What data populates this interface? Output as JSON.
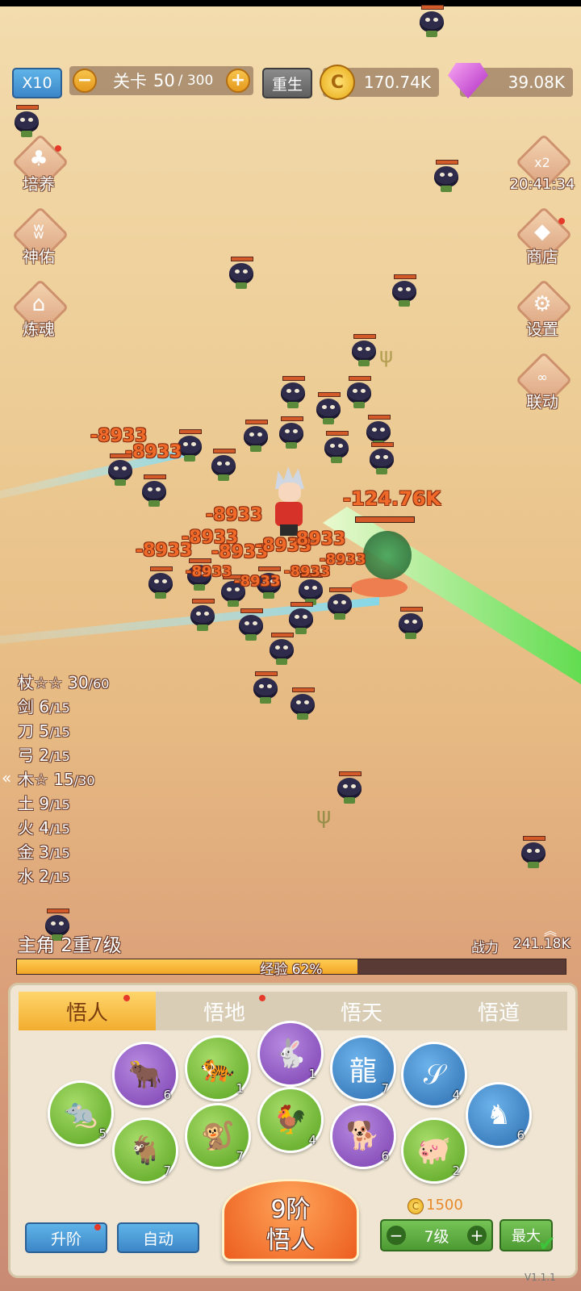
{
  "topbar": {
    "speed_label": "X10",
    "stage_prefix": "关卡",
    "stage_current": "50",
    "stage_total": "/ 300",
    "rebirth_label": "重生",
    "gold": "170.74K",
    "gems": "39.08K"
  },
  "left_menu": [
    {
      "label": "培养",
      "icon": "clover-icon"
    },
    {
      "label": "神佑",
      "icon": "wings-icon"
    },
    {
      "label": "炼魂",
      "icon": "house-icon"
    }
  ],
  "right_menu": {
    "boost_label": "x2",
    "boost_timer": "20:41:34",
    "items": [
      {
        "label": "商店",
        "icon": "gem-icon"
      },
      {
        "label": "设置",
        "icon": "gear-icon"
      },
      {
        "label": "联动",
        "icon": "link-icon"
      }
    ]
  },
  "damage_numbers": [
    "-8933",
    "-8933",
    "-8933",
    "-8933",
    "-8933",
    "-8933",
    "-8933",
    "-8933",
    "-8933",
    "-8933",
    "-8933",
    "-8933",
    "-124.76K"
  ],
  "stats": [
    {
      "name": "杖☆☆",
      "value": "30",
      "max": "/60"
    },
    {
      "name": "剑",
      "value": "6",
      "max": "/15"
    },
    {
      "name": "刀",
      "value": "5",
      "max": "/15"
    },
    {
      "name": "弓",
      "value": "2",
      "max": "/15"
    },
    {
      "name": "木☆",
      "value": "15",
      "max": "/30"
    },
    {
      "name": "土",
      "value": "9",
      "max": "/15"
    },
    {
      "name": "火",
      "value": "4",
      "max": "/15"
    },
    {
      "name": "金",
      "value": "3",
      "max": "/15"
    },
    {
      "name": "水",
      "value": "2",
      "max": "/15"
    }
  ],
  "hero": {
    "level_text": "主角 2重7级",
    "power_label": "战力",
    "power_value": "241.18K",
    "exp_text": "经验 62%",
    "exp_percent": 62
  },
  "panel": {
    "tabs": [
      "悟人",
      "悟地",
      "悟天",
      "悟道"
    ],
    "zodiac": [
      {
        "name": "rat-icon",
        "level": "5",
        "color": "green"
      },
      {
        "name": "ox-icon",
        "level": "6",
        "color": "purple"
      },
      {
        "name": "tiger-icon",
        "level": "1",
        "color": "green"
      },
      {
        "name": "rabbit-icon",
        "level": "1",
        "color": "purple"
      },
      {
        "name": "dragon-icon",
        "level": "7",
        "color": "blue"
      },
      {
        "name": "snake-icon",
        "level": "4",
        "color": "blue"
      },
      {
        "name": "horse-icon",
        "level": "6",
        "color": "blue"
      },
      {
        "name": "goat-icon",
        "level": "7",
        "color": "green"
      },
      {
        "name": "monkey-icon",
        "level": "7",
        "color": "green"
      },
      {
        "name": "rooster-icon",
        "level": "4",
        "color": "green"
      },
      {
        "name": "dog-icon",
        "level": "6",
        "color": "purple"
      },
      {
        "name": "pig-icon",
        "level": "2",
        "color": "green"
      }
    ],
    "upgrade_label": "升阶",
    "auto_label": "自动",
    "main_button_line1": "9阶",
    "main_button_line2": "悟人",
    "cost": "1500",
    "level_value": "7级",
    "max_label": "最大",
    "version": "V1.1.1"
  },
  "colors": {
    "accent_orange": "#f06a2a",
    "exp_bar": "#f2a624",
    "beam_green": "#6bf05a",
    "beam_cyan": "#5fd2f0"
  }
}
